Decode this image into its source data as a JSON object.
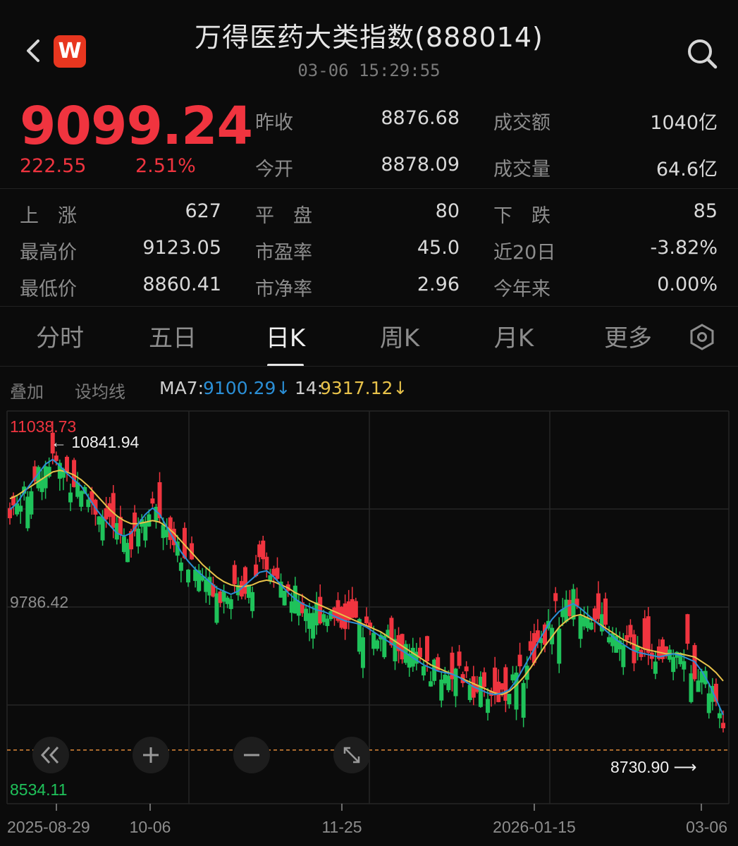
{
  "header": {
    "title": "万得医药大类指数(888014)",
    "timestamp": "03-06  15:29:55",
    "logo_text": "W"
  },
  "quote": {
    "price": "9099.24",
    "change": "222.55",
    "change_pct": "2.51%",
    "prev_close_label": "昨收",
    "prev_close": "8876.68",
    "open_label": "今开",
    "open": "8878.09",
    "amount_label": "成交额",
    "amount": "1040亿",
    "volume_label": "成交量",
    "volume": "64.6亿"
  },
  "stats": {
    "up_label": "上　涨",
    "up": "627",
    "flat_label": "平　盘",
    "flat": "80",
    "down_label": "下　跌",
    "down": "85",
    "high_label": "最高价",
    "high": "9123.05",
    "pe_label": "市盈率",
    "pe": "45.0",
    "d20_label": "近20日",
    "d20": "-3.82%",
    "low_label": "最低价",
    "low": "8860.41",
    "pb_label": "市净率",
    "pb": "2.96",
    "ytd_label": "今年来",
    "ytd": "0.00%"
  },
  "tabs": [
    "分时",
    "五日",
    "日K",
    "周K",
    "月K",
    "更多"
  ],
  "active_tab": "日K",
  "indicators": {
    "overlay_label": "叠加",
    "ma_setting_label": "设均线",
    "ma7_label": "MA7:",
    "ma7_value": "9100.29↓",
    "ma14_label": "14:",
    "ma14_value": "9317.12↓"
  },
  "colors": {
    "up": "#f0343f",
    "down": "#1fc25a",
    "ma7": "#2b8fd6",
    "ma14": "#e8c24a",
    "accent": "#e8361f"
  },
  "chart_data": {
    "type": "candlestick",
    "y_axis_labels": {
      "top": "11038.73",
      "mid": "9786.42",
      "bottom": "8534.11"
    },
    "ylim": [
      8534.11,
      11038.73
    ],
    "max_annotation": "10841.94",
    "min_annotation": "8730.90",
    "prev_close_line": 8876.68,
    "x_labels": [
      "2025-08-29",
      "10-06",
      "11-25",
      "2026-01-15",
      "03-06"
    ],
    "ma7_close": [
      10410,
      10450,
      10520,
      10580,
      10640,
      10700,
      10730,
      10690,
      10640,
      10600,
      10560,
      10490,
      10420,
      10360,
      10310,
      10260,
      10240,
      10260,
      10320,
      10380,
      10420,
      10380,
      10300,
      10220,
      10140,
      10080,
      10030,
      9990,
      9950,
      9910,
      9890,
      9870,
      9890,
      9930,
      9970,
      10010,
      10020,
      9980,
      9930,
      9880,
      9840,
      9810,
      9790,
      9770,
      9760,
      9740,
      9720,
      9700,
      9690,
      9680,
      9660,
      9630,
      9600,
      9570,
      9540,
      9510,
      9480,
      9450,
      9420,
      9400,
      9380,
      9370,
      9360,
      9340,
      9310,
      9280,
      9260,
      9240,
      9230,
      9240,
      9260,
      9320,
      9400,
      9480,
      9560,
      9640,
      9710,
      9760,
      9790,
      9810,
      9780,
      9740,
      9700,
      9660,
      9620,
      9580,
      9550,
      9520,
      9500,
      9490,
      9480,
      9470,
      9480,
      9490,
      9480,
      9460,
      9440,
      9380,
      9300,
      9200,
      9100
    ],
    "ma14_close": [
      10480,
      10500,
      10530,
      10560,
      10590,
      10620,
      10650,
      10660,
      10650,
      10630,
      10600,
      10560,
      10510,
      10460,
      10410,
      10370,
      10340,
      10320,
      10320,
      10330,
      10340,
      10330,
      10300,
      10260,
      10210,
      10160,
      10110,
      10060,
      10020,
      9980,
      9950,
      9930,
      9920,
      9920,
      9930,
      9950,
      9960,
      9950,
      9930,
      9910,
      9880,
      9860,
      9830,
      9810,
      9790,
      9770,
      9750,
      9730,
      9710,
      9690,
      9670,
      9650,
      9630,
      9600,
      9570,
      9540,
      9510,
      9480,
      9450,
      9420,
      9400,
      9380,
      9360,
      9340,
      9320,
      9300,
      9280,
      9260,
      9240,
      9230,
      9250,
      9290,
      9340,
      9400,
      9470,
      9540,
      9600,
      9660,
      9700,
      9730,
      9740,
      9720,
      9700,
      9670,
      9640,
      9610,
      9580,
      9560,
      9540,
      9520,
      9510,
      9500,
      9490,
      9490,
      9490,
      9480,
      9470,
      9440,
      9410,
      9370,
      9317
    ]
  },
  "controls": {
    "rewind_icon": "double-chevron-left-icon",
    "zoom_in_icon": "plus-icon",
    "zoom_out_icon": "minus-icon",
    "fullscreen_icon": "expand-arrows-icon"
  }
}
